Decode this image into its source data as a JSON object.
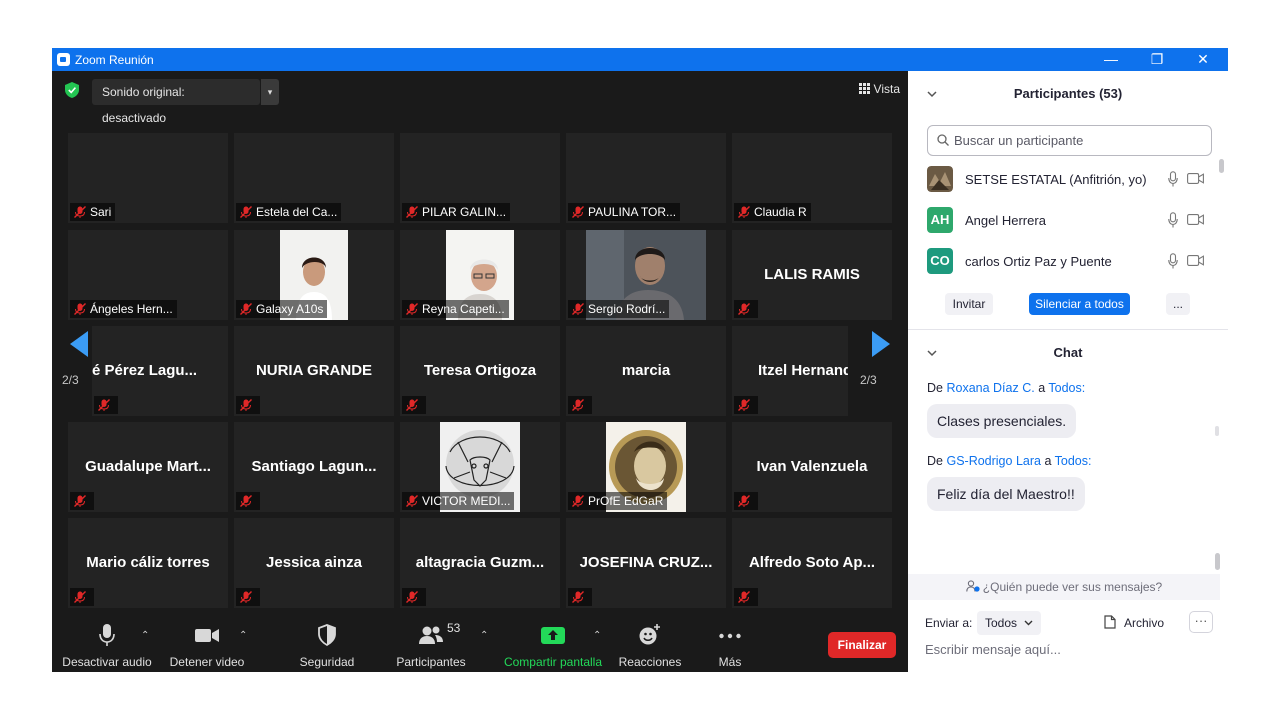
{
  "window": {
    "title": "Zoom Reunión",
    "min": "—",
    "max": "❐",
    "close": "✕"
  },
  "stage": {
    "sound": "Sonido original: desactivado",
    "sound_caret": "▾",
    "view": "Vista",
    "page_left": "2/3",
    "page_right": "2/3"
  },
  "tiles": [
    {
      "label": "Sari"
    },
    {
      "label": "Estela del Ca..."
    },
    {
      "label": "PILAR GALIN..."
    },
    {
      "label": "PAULINA TOR..."
    },
    {
      "label": "Claudia R"
    },
    {
      "label": "Ángeles Hern..."
    },
    {
      "label": "Galaxy A10s"
    },
    {
      "label": "Reyna Capeti..."
    },
    {
      "label": "Sergio Rodrí..."
    },
    {
      "big": "LALIS RAMIS"
    },
    {
      "big": "é Pérez Lagu..."
    },
    {
      "big": "NURIA GRANDE"
    },
    {
      "big": "Teresa Ortigoza"
    },
    {
      "big": "marcia"
    },
    {
      "big": "Itzel Hernand"
    },
    {
      "big": "Guadalupe  Mart..."
    },
    {
      "big": "Santiago  Lagun..."
    },
    {
      "label": "VICTOR MEDI..."
    },
    {
      "label": "PrOfE EdGaR"
    },
    {
      "big": "Ivan Valenzuela"
    },
    {
      "big": "Mario cáliz torres"
    },
    {
      "big": "Jessica ainza"
    },
    {
      "big": "altagracia  Guzm..."
    },
    {
      "big": "JOSEFINA  CRUZ..."
    },
    {
      "big": "Alfredo Soto Ap..."
    }
  ],
  "toolbar": {
    "audio": "Desactivar audio",
    "video": "Detener video",
    "security": "Seguridad",
    "participants": "Participantes",
    "participants_count": "53",
    "share": "Compartir pantalla",
    "reactions": "Reacciones",
    "more": "Más",
    "end": "Finalizar"
  },
  "panel": {
    "participants_title": "Participantes (53)",
    "search_placeholder": "Buscar un participante",
    "participants": [
      {
        "name": "SETSE ESTATAL (Anfitrión, yo)",
        "initials": "",
        "color": "#6b5a44"
      },
      {
        "name": "Angel Herrera",
        "initials": "AH",
        "color": "#2ea86c"
      },
      {
        "name": "carlos Ortiz Paz y Puente",
        "initials": "CO",
        "color": "#1e9a7e"
      }
    ],
    "invite": "Invitar",
    "mute_all": "Silenciar a todos",
    "more": "...",
    "chat_title": "Chat",
    "messages": [
      {
        "prefix": "De",
        "from": "Roxana Díaz C.",
        "mid": "a",
        "to": "Todos:",
        "text": "Clases presenciales."
      },
      {
        "prefix": "De",
        "from": "GS-Rodrigo Lara",
        "mid": "a",
        "to": "Todos:",
        "text": "Feliz día del Maestro!!"
      }
    ],
    "who_can_see": "¿Quién puede ver sus mensajes?",
    "send_to_label": "Enviar a:",
    "send_to_value": "Todos",
    "file": "Archivo",
    "input_placeholder": "Escribir mensaje aquí..."
  },
  "colors": {
    "accent": "#0e72ed",
    "end": "#e02828",
    "share": "#23d959",
    "mute_red": "#e02828"
  }
}
